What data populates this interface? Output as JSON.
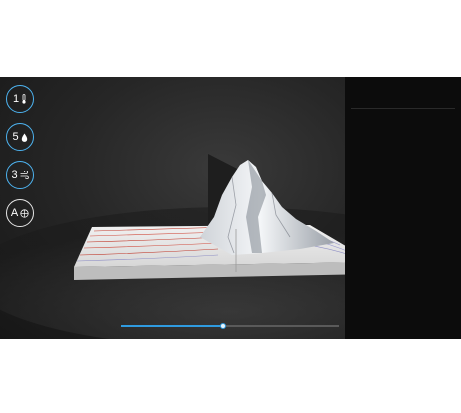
{
  "tools": [
    {
      "num": "1",
      "icon": "thermometer-icon",
      "accent": "#4db3f0"
    },
    {
      "num": "5",
      "icon": "water-drop-icon",
      "accent": "#4db3f0"
    },
    {
      "num": "3",
      "icon": "wind-icon",
      "accent": "#4db3f0"
    },
    {
      "num": "A",
      "icon": "compass-icon",
      "accent": "#e6e6e6"
    }
  ],
  "panel": {
    "kicker": "",
    "title": "",
    "stats": [
      "",
      "",
      ""
    ],
    "paragraph_1": "",
    "paragraph_2": ""
  },
  "timeline": {
    "progress": 0.47
  },
  "colors": {
    "accent": "#2f9be0",
    "panel_bg": "#0c0c0c",
    "stage_bg": "#262626"
  }
}
